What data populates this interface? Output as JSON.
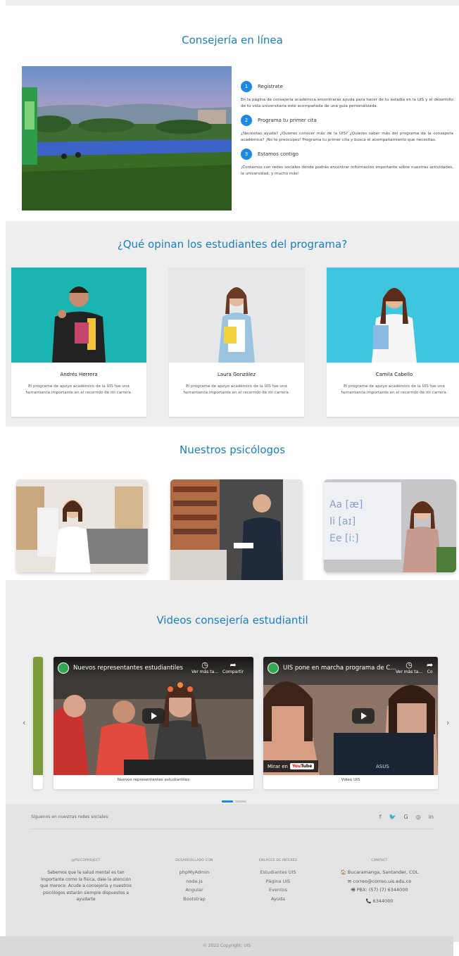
{
  "consejeria": {
    "title": "Consejería en línea",
    "steps": [
      {
        "num": "1",
        "title": "Regístrate",
        "text": "En la página de consejería académica encontrarás ayuda para hacer de tu estadía en la UIS y el desarrollo de tu vida universitaria esté acompañada de una guía personalizada."
      },
      {
        "num": "2",
        "title": "Programa tu primer cita",
        "text": "¿Necesitas ayuda? ¿Quieres conocer más de la UIS? ¿Quieres saber más del programa de la consejería académica? ¡No te preocupes! Programa tu primer cita y busca el acompañamiento que necesitas."
      },
      {
        "num": "3",
        "title": "Estamos contigo",
        "text": "¡Contamos con redes sociales donde podrás encontrar información importante sobre nuestras actividades, la universidad, y mucho más!"
      }
    ]
  },
  "opiniones": {
    "title": "¿Qué opinan los estudiantes del programa?",
    "testimonials": [
      {
        "name": "Andrés Herrera",
        "quote": "El programa de apoyo académico de la UIS fue una herramienta importante en el recorrido de mi carrera."
      },
      {
        "name": "Laura González",
        "quote": "El programa de apoyo académico de la UIS fue una herramienta importante en el recorrido de mi carrera."
      },
      {
        "name": "Camila Cabello",
        "quote": "El programa de apoyo académico de la UIS fue una herramienta importante en el recorrido de mi carrera."
      }
    ]
  },
  "psicologos": {
    "title": "Nuestros psicólogos"
  },
  "videos": {
    "title": "Videos consejería estudiantil",
    "prev_arrow": "‹",
    "next_arrow": "›",
    "items": [
      {
        "yt_title": "Nuevos representantes estudiantiles",
        "watch_later": "Ver más ta...",
        "share": "Compartir",
        "caption": "Nuevos representantes estudiantiles"
      },
      {
        "yt_title": "UIS pone en marcha programa de C...",
        "watch_later": "Ver más ta...",
        "share": "Co",
        "caption": "Video UIS",
        "watch_on": "Mirar en",
        "yt_logo_a": "You",
        "yt_logo_b": "Tube"
      }
    ]
  },
  "footer": {
    "social_label": "Síguenos en nuestras redes sociales:",
    "social_icons": [
      "f",
      "🐦",
      "G",
      "◎",
      "in"
    ],
    "col1": {
      "heading": "@PSICOPROJECT",
      "text": "Sabemos que la salud mental es tan importante como la física, dale la atención que merece. Acude a consejería y nuestros psicólogos estarán siempre dispuestos a ayudarte"
    },
    "col2": {
      "heading": "DESARROLLADO CON",
      "links": [
        "phpMyAdmin",
        "node.js",
        "Angular",
        "Bootstrap"
      ]
    },
    "col3": {
      "heading": "ENLACES DE INTERÉS",
      "links": [
        "Estudiantes UIS",
        "Página UIS",
        "Eventos",
        "Ayuda"
      ]
    },
    "col4": {
      "heading": "CONTACT",
      "items": [
        {
          "icon": "🏠",
          "text": "Bucaramanga, Santander, COL"
        },
        {
          "icon": "✉",
          "text": "correo@correo.uis.edu.co"
        },
        {
          "icon": "🖷",
          "text": "PBX: (57) (7) 6344000"
        },
        {
          "icon": "📞",
          "text": "6344000"
        }
      ]
    },
    "copyright": "© 2022 Copyright: UIS"
  }
}
